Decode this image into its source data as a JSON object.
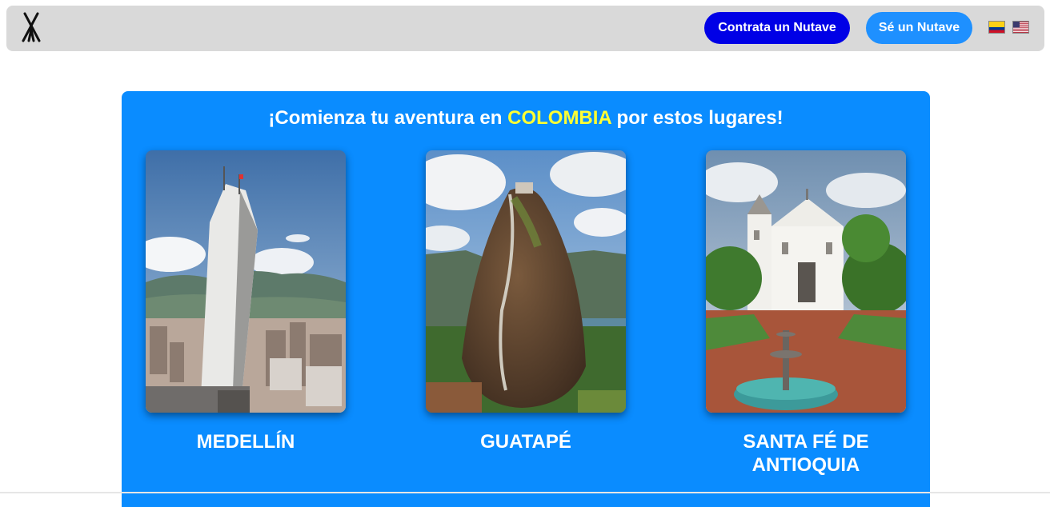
{
  "navbar": {
    "logo_icon": "tent-logo-icon",
    "hire_button": "Contrata un Nutave",
    "be_button": "Sé un Nutave",
    "languages": [
      {
        "icon": "colombia-flag-icon"
      },
      {
        "icon": "usa-flag-icon"
      }
    ]
  },
  "main": {
    "headline_prefix": "¡Comienza tu aventura en ",
    "headline_highlight": "COLOMBIA",
    "headline_suffix": " por estos lugares!",
    "destinations": [
      {
        "name": "MEDELLÍN",
        "image": "medellin-tower-photo"
      },
      {
        "name": "GUATAPÉ",
        "image": "guatape-rock-photo"
      },
      {
        "name": "SANTA FÉ DE ANTIOQUIA",
        "image": "santa-fe-church-photo"
      }
    ]
  },
  "colors": {
    "navbar_bg": "#d9d9d9",
    "hire_button": "#0000e6",
    "be_button": "#1e90ff",
    "panel_bg": "#0a8cff",
    "highlight": "#ffff33"
  }
}
